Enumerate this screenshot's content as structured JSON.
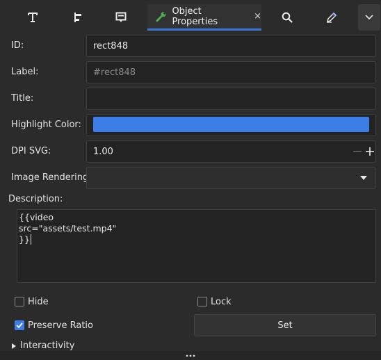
{
  "tabs": {
    "active_label": "Object Properties",
    "close_glyph": "×",
    "icons": [
      "text-tool-icon",
      "align-distribute-icon",
      "symbol-icon",
      "wrench-icon",
      "search-icon",
      "edit-pen-icon",
      "chevron-down-icon"
    ]
  },
  "fields": {
    "id_label": "ID:",
    "id_value": "rect848",
    "label_label": "Label:",
    "label_placeholder": "#rect848",
    "title_label": "Title:",
    "title_value": "",
    "highlight_label": "Highlight Color:",
    "highlight_color": "#3c7ee6",
    "dpi_label": "DPI SVG:",
    "dpi_value": "1.00",
    "rendering_label": "Image Rendering:",
    "rendering_value": "",
    "description_label": "Description:",
    "description_lines": [
      "{{video",
      "src=\"assets/test.mp4\"",
      "}}"
    ]
  },
  "options": {
    "hide_label": "Hide",
    "hide_checked": false,
    "lock_label": "Lock",
    "lock_checked": false,
    "preserve_label": "Preserve Ratio",
    "preserve_checked": true,
    "set_label": "Set",
    "interactivity_label": "Interactivity"
  }
}
